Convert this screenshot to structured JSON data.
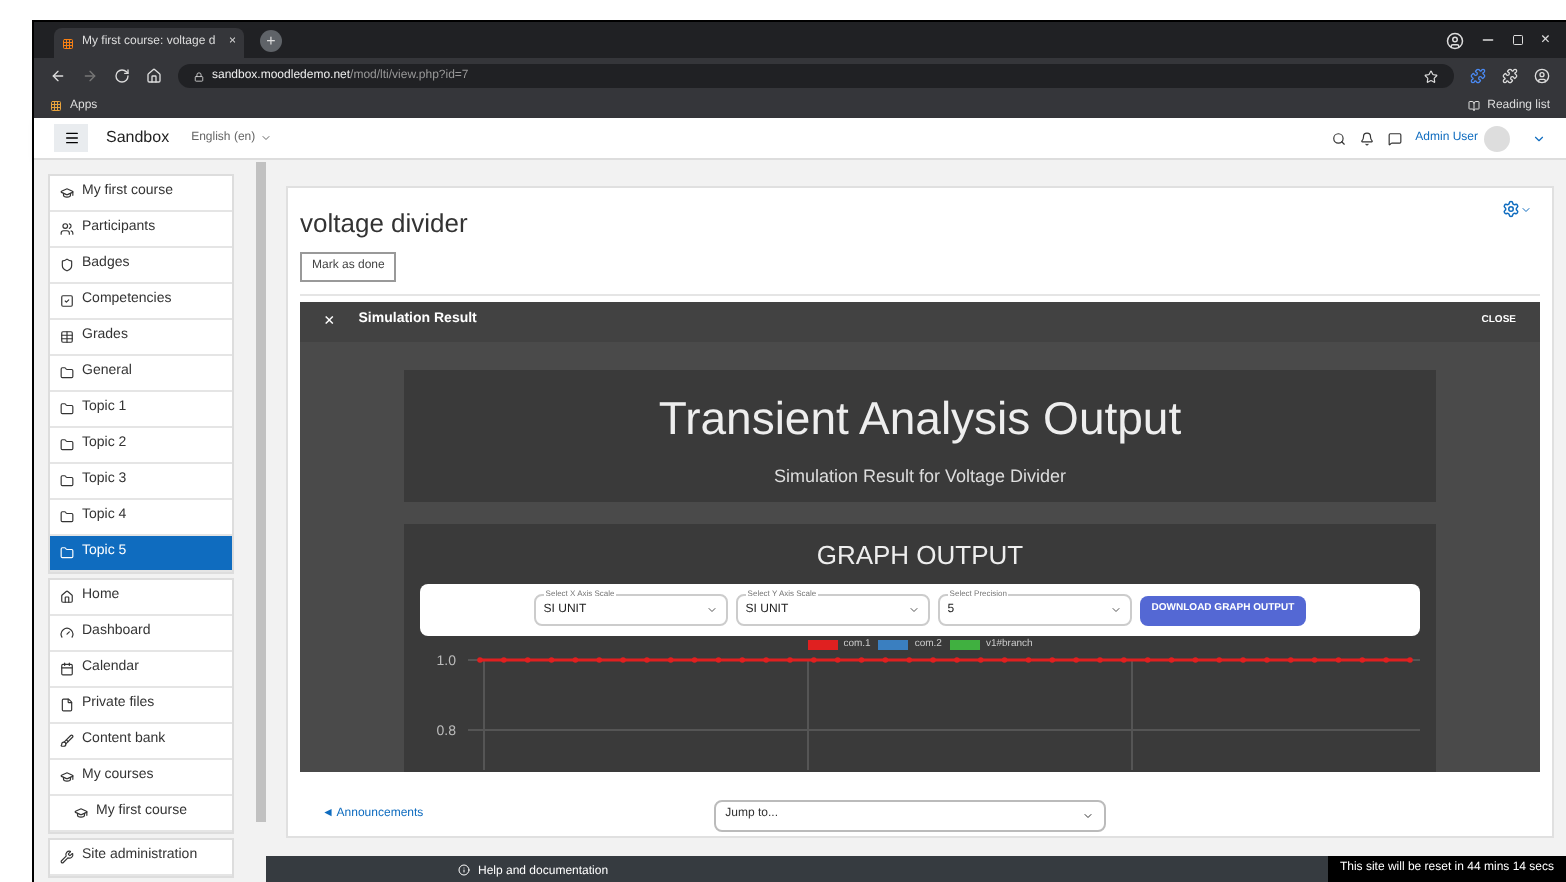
{
  "browser": {
    "tab_title": "My first course: voltage d",
    "tab_close": "×",
    "new_tab": "+",
    "url_host": "sandbox.moodledemo.net",
    "url_path": "/mod/lti/view.php?id=7",
    "bookmarks": [
      {
        "label": "Apps"
      }
    ],
    "reading_list": "Reading list"
  },
  "navbar": {
    "site": "Sandbox",
    "language": "English (en)",
    "user": "Admin User"
  },
  "sidebar": {
    "groups": [
      [
        {
          "label": "My first course",
          "selected": false
        },
        {
          "label": "Participants",
          "selected": false
        },
        {
          "label": "Badges",
          "selected": false
        },
        {
          "label": "Competencies",
          "selected": false
        },
        {
          "label": "Grades",
          "selected": false
        },
        {
          "label": "General",
          "selected": false
        },
        {
          "label": "Topic 1",
          "selected": false
        },
        {
          "label": "Topic 2",
          "selected": false
        },
        {
          "label": "Topic 3",
          "selected": false
        },
        {
          "label": "Topic 4",
          "selected": false
        },
        {
          "label": "Topic 5",
          "selected": true
        }
      ],
      [
        {
          "label": "Home",
          "selected": false
        },
        {
          "label": "Dashboard",
          "selected": false
        },
        {
          "label": "Calendar",
          "selected": false
        },
        {
          "label": "Private files",
          "selected": false
        },
        {
          "label": "Content bank",
          "selected": false
        },
        {
          "label": "My courses",
          "selected": false,
          "children": [
            {
              "label": "My first course",
              "selected": false
            }
          ]
        }
      ],
      [
        {
          "label": "Site administration",
          "selected": false
        }
      ]
    ]
  },
  "page": {
    "title": "voltage divider",
    "mark_button": "Mark as done"
  },
  "simulation": {
    "close_symbol": "×",
    "title": "Simulation Result",
    "close_button": "CLOSE",
    "heading": "Transient Analysis Output",
    "subheading": "Simulation Result for Voltage Divider",
    "graph_title": "GRAPH OUTPUT",
    "selects": [
      {
        "label": "Select X Axis Scale",
        "value": "SI UNIT"
      },
      {
        "label": "Select Y Axis Scale",
        "value": "SI UNIT"
      },
      {
        "label": "Select Precision",
        "value": "5"
      }
    ],
    "download_button": "DOWNLOAD GRAPH OUTPUT",
    "chart_data": {
      "type": "line",
      "legend": "top",
      "yticks": [
        {
          "value": 0.8,
          "label": "0.8"
        },
        {
          "value": 1,
          "label": "1.0"
        }
      ],
      "ylim": [
        0.8,
        1.0
      ],
      "series": [
        {
          "name": "com.1",
          "color": "#e02020",
          "values": [
            1,
            1,
            1,
            1,
            1,
            1,
            1,
            1,
            1,
            1,
            1,
            1,
            1,
            1,
            1,
            1,
            1,
            1,
            1,
            1,
            1,
            1,
            1,
            1,
            1,
            1,
            1,
            1,
            1,
            1,
            1,
            1,
            1,
            1,
            1,
            1,
            1,
            1,
            1,
            1
          ]
        },
        {
          "name": "com.2",
          "color": "#3a7fc0"
        },
        {
          "name": "v1#branch",
          "color": "#40b040"
        }
      ]
    }
  },
  "activity_nav": {
    "previous_arrow": "◄",
    "previous": "Announcements",
    "jump": "Jump to..."
  },
  "footer": {
    "help": "Help and documentation",
    "reset_notice": "This site will be reset in 44 mins 14 secs"
  }
}
